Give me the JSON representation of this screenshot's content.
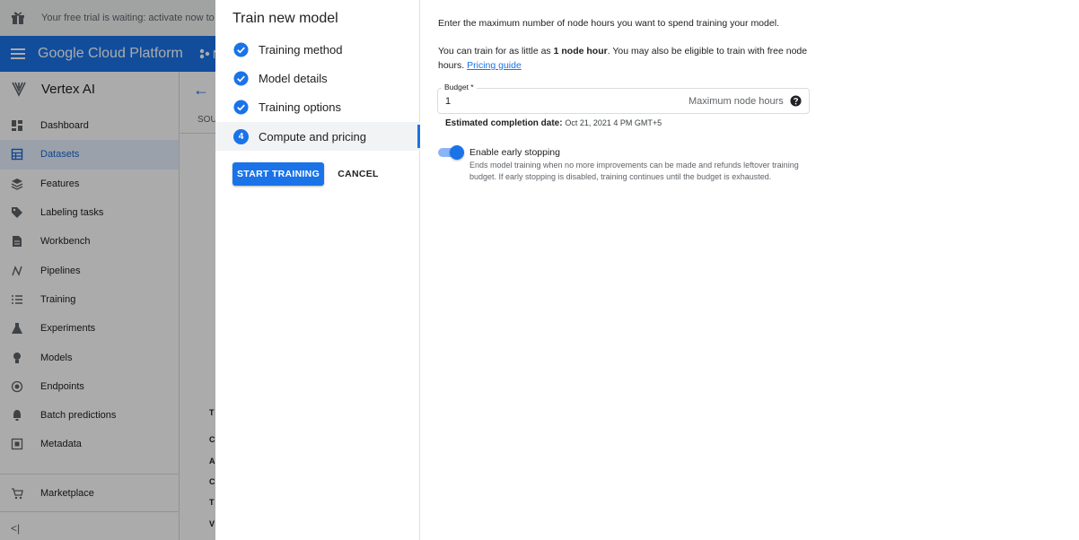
{
  "background": {
    "trial_text": "Your free trial is waiting: activate now to get",
    "brand": "Google Cloud Platform",
    "project_initial": "N",
    "product": "Vertex AI",
    "nav": [
      {
        "label": "Dashboard",
        "icon": "dashboard-icon"
      },
      {
        "label": "Datasets",
        "icon": "datasets-icon",
        "active": true
      },
      {
        "label": "Features",
        "icon": "features-icon"
      },
      {
        "label": "Labeling tasks",
        "icon": "labeling-icon"
      },
      {
        "label": "Workbench",
        "icon": "workbench-icon"
      },
      {
        "label": "Pipelines",
        "icon": "pipelines-icon"
      },
      {
        "label": "Training",
        "icon": "training-icon"
      },
      {
        "label": "Experiments",
        "icon": "experiments-icon"
      },
      {
        "label": "Models",
        "icon": "models-icon"
      },
      {
        "label": "Endpoints",
        "icon": "endpoints-icon"
      },
      {
        "label": "Batch predictions",
        "icon": "batch-predictions-icon"
      },
      {
        "label": "Metadata",
        "icon": "metadata-icon"
      }
    ],
    "marketplace": "Marketplace",
    "collapse_glyph": "<|",
    "source_tab": "SOU",
    "table_letters": [
      "T",
      "C",
      "A",
      "C",
      "T",
      "V"
    ]
  },
  "dialog": {
    "title": "Train new model",
    "steps": [
      {
        "label": "Training method",
        "state": "done"
      },
      {
        "label": "Model details",
        "state": "done"
      },
      {
        "label": "Training options",
        "state": "done"
      },
      {
        "label": "Compute and pricing",
        "state": "active",
        "number": "4"
      }
    ],
    "start_button": "START TRAINING",
    "cancel_button": "CANCEL",
    "intro": "Enter the maximum number of node hours you want to spend training your model.",
    "min_text_a": "You can train for as little as ",
    "min_text_bold": "1 node hour",
    "min_text_b": ". You may also be eligible to train with free node hours. ",
    "pricing_link": "Pricing guide",
    "budget_label": "Budget *",
    "budget_value": "1",
    "budget_suffix": "Maximum node hours",
    "est_label": "Estimated completion date:",
    "est_value": "Oct 21, 2021 4 PM GMT+5",
    "early_stop_title": "Enable early stopping",
    "early_stop_desc": "Ends model training when no more improvements can be made and refunds leftover training budget. If early stopping is disabled, training continues until the budget is exhausted.",
    "early_stop_enabled": true
  },
  "colors": {
    "accent": "#1a73e8",
    "scrim": "rgba(0,0,0,0.33)"
  }
}
